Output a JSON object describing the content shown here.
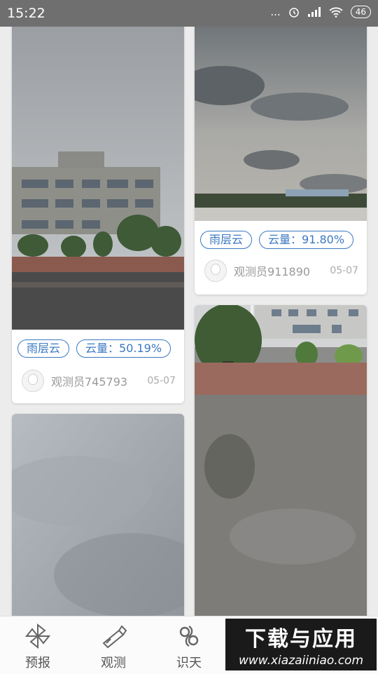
{
  "status_bar": {
    "time": "15:22",
    "dots": "...",
    "battery": "46"
  },
  "cards": [
    {
      "tag_type": "雨层云",
      "tag_amount": "云量：50.19%",
      "observer": "观测员745793",
      "date": "05-07"
    },
    {
      "tag_type": "雨层云",
      "tag_amount": "云量：91.80%",
      "observer": "观测员911890",
      "date": "05-07"
    }
  ],
  "nav": [
    {
      "label": "预报",
      "icon": "pinwheel-icon"
    },
    {
      "label": "观测",
      "icon": "telescope-icon"
    },
    {
      "label": "识天",
      "icon": "cloud-swirl-icon"
    }
  ],
  "watermark": {
    "title": "下载与应用",
    "url": "www.xiazaiiniao.com"
  },
  "colors": {
    "accent": "#3a78c2",
    "status_bar": "#6f6f6f"
  }
}
